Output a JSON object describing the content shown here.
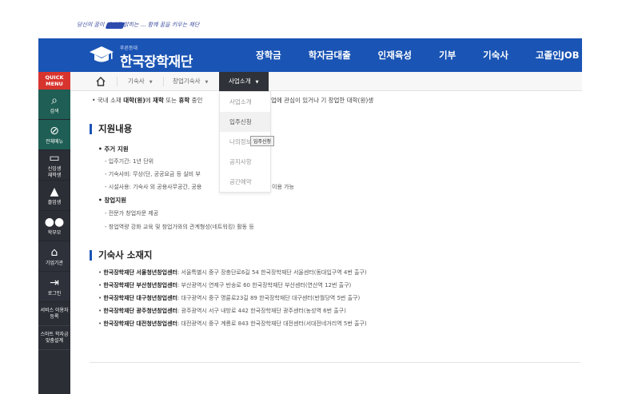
{
  "slogan": "당신의 꿈이 세상을 밝히는 ... 함께 꿈을 키우는 재단",
  "header": {
    "logo_sub": "푸른등대",
    "logo_name": "한국장학재단",
    "nav": [
      "장학금",
      "학자금대출",
      "인재육성",
      "기부",
      "기숙사",
      "고졸인JOB"
    ]
  },
  "quick_menu": {
    "head": "QUICK\nMENU",
    "items": [
      {
        "icon": "search-icon",
        "glyph": "Q",
        "label": "검색"
      },
      {
        "icon": "compass-icon",
        "glyph": "⊘",
        "label": "전체메뉴"
      },
      {
        "icon": "book-icon",
        "glyph": "▭",
        "label": "신입생\n재학생"
      },
      {
        "icon": "graduation-cap-icon",
        "glyph": "🎓",
        "label": "졸업생"
      },
      {
        "icon": "people-icon",
        "glyph": "👥",
        "label": "학부모"
      },
      {
        "icon": "building-icon",
        "glyph": "🏛",
        "label": "기업기관"
      },
      {
        "icon": "login-icon",
        "glyph": "⇥",
        "label": "로그인"
      }
    ],
    "texts": [
      "서비스 이용자\n등록",
      "스마트 학자금\n맞춤설계"
    ]
  },
  "breadcrumb": {
    "items": [
      "기숙사",
      "창업기숙사"
    ],
    "active": "사업소개"
  },
  "dropdown": {
    "items": [
      "사업소개",
      "입주신청",
      "나의정보",
      "공지사항",
      "공간예약"
    ],
    "hovered_index": 1,
    "tooltip": "입주신청"
  },
  "content": {
    "intro_prefix": "• 국내 소재 ",
    "intro_b1": "대학(원)",
    "intro_mid1": "에 ",
    "intro_b2": "재학",
    "intro_mid2": " 또는 ",
    "intro_b3": "휴학",
    "intro_mid3": " 중인",
    "intro_tail": "업에 관심이 있거나 기 창업한 대학(원)생",
    "support_title": "지원내용",
    "housing_title": "• 주거 지원",
    "housing_lines": [
      "- 입주기간: 1년 단위",
      "- 기숙사비: 무상(단, 공공요금 등 실비 부",
      "- 시설사용: 기숙사 외 공용사무공간, 공용"
    ],
    "housing_line3_tail": "이용 가능",
    "startup_title": "• 창업지원",
    "startup_lines": [
      "- 전문가 창업자문 제공",
      "- 창업역량 강화 교육 및 창업가와의 관계형성(네트워킹) 활동 등"
    ],
    "location_title": "기숙사 소재지",
    "centers": [
      {
        "name": "한국장학재단 서울청년창업센터",
        "addr": ": 서울특별시 중구 장충단로6길 54 한국장학재단 서울센터(동대입구역 4번 출구)"
      },
      {
        "name": "한국장학재단 부산청년창업센터",
        "addr": ": 부산광역시 연제구 반송로 60 한국장학재단 부산센터(연산역 12번 출구)"
      },
      {
        "name": "한국장학재단 대구청년창업센터",
        "addr": ": 대구광역시 중구 명륜로23길 89 한국장학재단 대구센터(반월당역 5번 출구)"
      },
      {
        "name": "한국장학재단 광주청년창업센터",
        "addr": ": 광주광역시 서구 내방로 442 한국장학재단 광주센터(농성역 6번 출구)"
      },
      {
        "name": "한국장학재단 대전청년창업센터",
        "addr": ": 대전광역시 중구 계룡로 843 한국장학재단 대전센터(서대전네거리역 5번 출구)"
      }
    ]
  },
  "colors": {
    "brand_blue": "#1a54b4",
    "quick_red": "#d8342e",
    "quick_green": "#1f5e54",
    "quick_dark": "#2b2e35"
  }
}
